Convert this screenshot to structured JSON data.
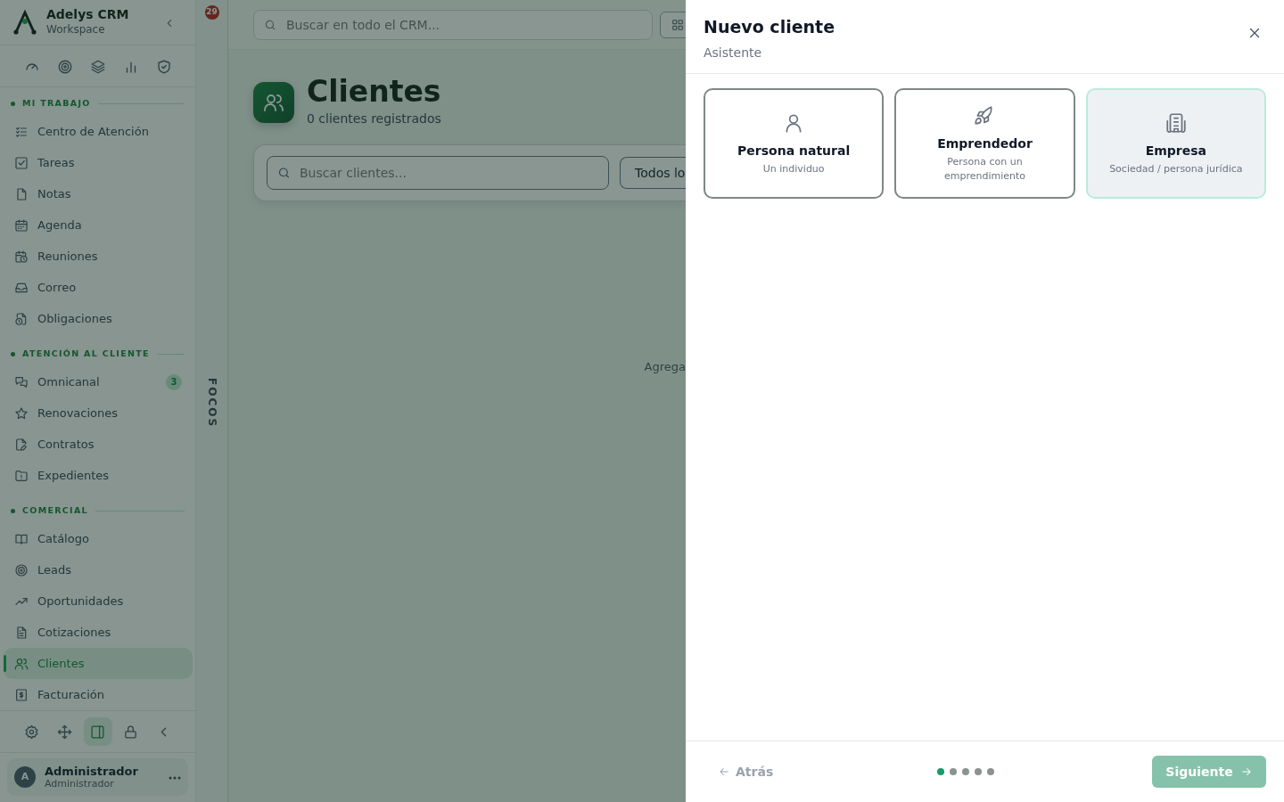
{
  "sidebar": {
    "brand": {
      "name": "Adelys CRM",
      "subtitle": "Workspace"
    },
    "sections": [
      {
        "title": "MI TRABAJO",
        "items": [
          {
            "label": "Centro de Atención",
            "selected": false
          },
          {
            "label": "Tareas",
            "selected": false
          },
          {
            "label": "Notas",
            "selected": false
          },
          {
            "label": "Agenda",
            "selected": false
          },
          {
            "label": "Reuniones",
            "selected": false
          },
          {
            "label": "Correo",
            "selected": false
          },
          {
            "label": "Obligaciones",
            "selected": false
          }
        ]
      },
      {
        "title": "ATENCIÓN AL CLIENTE",
        "items": [
          {
            "label": "Omnicanal",
            "selected": false,
            "badge": "3"
          },
          {
            "label": "Renovaciones",
            "selected": false
          },
          {
            "label": "Contratos",
            "selected": false
          },
          {
            "label": "Expedientes",
            "selected": false
          }
        ]
      },
      {
        "title": "COMERCIAL",
        "items": [
          {
            "label": "Catálogo",
            "selected": false
          },
          {
            "label": "Leads",
            "selected": false
          },
          {
            "label": "Oportunidades",
            "selected": false
          },
          {
            "label": "Cotizaciones",
            "selected": false
          },
          {
            "label": "Clientes",
            "selected": true
          },
          {
            "label": "Facturación",
            "selected": false
          }
        ]
      }
    ],
    "tools": [
      {
        "selected": false
      },
      {
        "selected": false
      },
      {
        "selected": true
      },
      {
        "selected": false
      },
      {
        "selected": false
      }
    ],
    "user": {
      "initial": "A",
      "name": "Administrador",
      "role": "Administrador"
    }
  },
  "rail": {
    "badge": "29",
    "label": "FOCOS"
  },
  "topbar": {
    "search_placeholder": "Buscar en todo el CRM..."
  },
  "page": {
    "title": "Clientes",
    "subtitle": "0 clientes registrados",
    "search_placeholder": "Buscar clientes...",
    "filter": "Todos lo",
    "empty_text": "Agrega"
  },
  "drawer": {
    "title": "Nuevo cliente",
    "subtitle": "Asistente",
    "options": [
      {
        "title": "Persona natural",
        "description": "Un individuo",
        "selected": false
      },
      {
        "title": "Emprendedor",
        "description": "Persona con un emprendimiento",
        "selected": false
      },
      {
        "title": "Empresa",
        "description": "Sociedad / persona jurídica",
        "selected": true
      }
    ],
    "steps": [
      {
        "selected": true
      },
      {
        "selected": false
      },
      {
        "selected": false
      },
      {
        "selected": false
      },
      {
        "selected": false
      }
    ],
    "back": "Atrás",
    "next": "Siguiente"
  }
}
